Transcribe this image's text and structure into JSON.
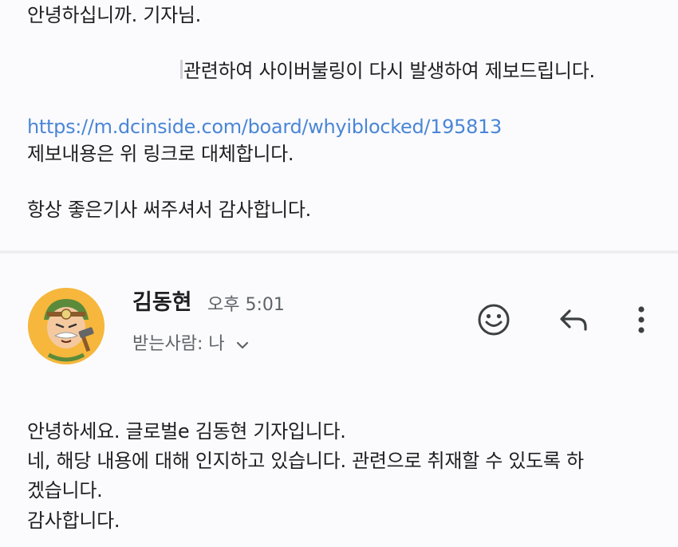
{
  "previous_message": {
    "greeting": "안녕하십니까. 기자님.",
    "report_line": "관련하여 사이버불링이 다시 발생하여 제보드립니다.",
    "link": "https://m.dcinside.com/board/whyiblocked/195813",
    "replace_line": "제보내용은 위 링크로 대체합니다.",
    "thanks_line": "항상 좋은기사 써주셔서 감사합니다."
  },
  "reply": {
    "sender_name": "김동현",
    "time": "오후 5:01",
    "recipient_label": "받는사람: 나",
    "avatar_icon": "cartoon-character-avatar-icon",
    "actions": {
      "emoji_icon": "emoji-reaction-icon",
      "reply_icon": "reply-arrow-icon",
      "more_icon": "more-vertical-icon"
    },
    "body": {
      "line1": "안녕하세요. 글로벌e 김동현 기자입니다.",
      "line2": "네, 해당 내용에 대해 인지하고 있습니다. 관련으로 취재할 수 있도록 하",
      "line3": "겠습니다.",
      "line4": "감사합니다."
    }
  },
  "colors": {
    "background": "#fbfbfe",
    "link": "#4a86d6",
    "secondary_text": "#5f6368",
    "divider": "#eeeef2",
    "avatar_bg": "#f6b73c"
  }
}
